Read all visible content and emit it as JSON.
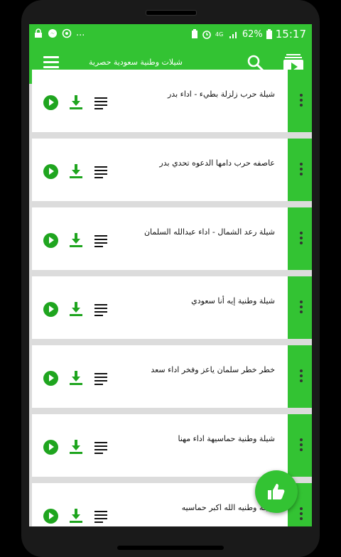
{
  "status_bar": {
    "left_icons": [
      "lock-icon",
      "messenger-icon",
      "sync-icon"
    ],
    "overflow": "...",
    "right_icons": [
      "battery-saver-icon",
      "alarm-icon",
      "signal-4g-icon",
      "signal-bars-icon"
    ],
    "battery": "62%",
    "time": "15:17"
  },
  "app_bar": {
    "title": "شيلات وطنية سعودية حصرية",
    "menu_icon": "hamburger-menu-icon",
    "search_icon": "search-icon",
    "youtube_icon": "youtube-icon"
  },
  "tracks": [
    {
      "title": "شيلة حرب  زلزلة بطيء - اداء بدر"
    },
    {
      "title": "عاصفه حرب  دامها الدعوه تحدي  بدر"
    },
    {
      "title": "شيلة رعد الشمال - اداء عبدالله السلمان"
    },
    {
      "title": "شيلة وطنية إيه أنا سعودي"
    },
    {
      "title": "خطر خطر  سلمان ياعز وفخر  اداء سعد"
    },
    {
      "title": "شيلة وطنية حماسيهة  اداء مهنا"
    },
    {
      "title": "شيلة وطنيه  الله اكبر  حماسيه"
    }
  ],
  "item_icons": {
    "play": "play-icon",
    "download": "download-icon",
    "lyrics": "lyrics-icon",
    "more": "more-vert-icon"
  },
  "fab": {
    "icon": "thumbs-up-icon"
  },
  "colors": {
    "primary": "#33c333",
    "icon_green": "#1fa51f",
    "background": "#dcdcdc"
  }
}
